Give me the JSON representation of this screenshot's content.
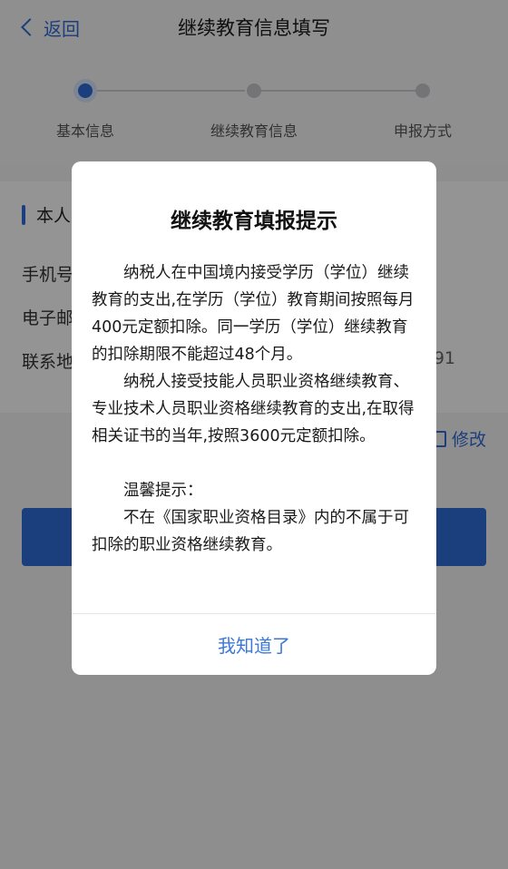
{
  "nav": {
    "back_label": "返回",
    "title": "继续教育信息填写"
  },
  "steps": [
    {
      "label": "基本信息"
    },
    {
      "label": "继续教育信息"
    },
    {
      "label": "申报方式"
    }
  ],
  "info_card": {
    "section_title_visible": "本人",
    "rows": [
      {
        "label_visible": "手机号"
      },
      {
        "label_visible": "电子邮"
      },
      {
        "label_visible": "联系地",
        "value_visible": "91"
      }
    ],
    "edit_label_visible": "修改"
  },
  "dialog": {
    "title": "继续教育填报提示",
    "paragraph_1": "纳税人在中国境内接受学历（学位）继续教育的支出,在学历（学位）教育期间按照每月400元定额扣除。同一学历（学位）继续教育的扣除期限不能超过48个月。",
    "paragraph_2": "纳税人接受技能人员职业资格继续教育、专业技术人员职业资格继续教育的支出,在取得相关证书的当年,按照3600元定额扣除。",
    "tip_heading": "温馨提示：",
    "tip_text": "不在《国家职业资格目录》内的不属于可扣除的职业资格继续教育。",
    "confirm_label": "我知道了"
  },
  "colors": {
    "accent": "#2f6bd8",
    "dialog_button": "#3b78d8",
    "overlay": "rgba(0,0,0,0.42)"
  }
}
